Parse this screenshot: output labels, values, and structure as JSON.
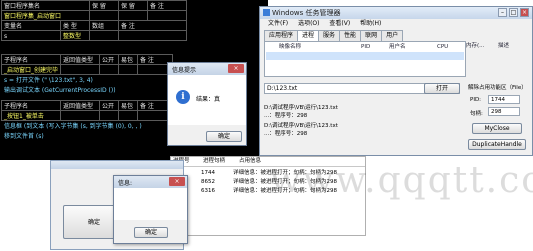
{
  "editor": {
    "table1_rows": [
      [
        "窗口程序集名",
        "保 留",
        "保 留",
        "备 注"
      ],
      [
        "窗口程序集_启动窗口",
        "",
        "",
        ""
      ],
      [
        "变量名",
        "类 型",
        "数组",
        "备 注"
      ],
      [
        "s",
        "整数型",
        "",
        ""
      ]
    ],
    "table2_header": [
      "子程序名",
      "返回值类型",
      "公开",
      "易包",
      "备 注"
    ],
    "table2_row": [
      "_启动窗口_创建完毕",
      "",
      "",
      "",
      ""
    ],
    "code_lines": [
      "s = 打开文件 (\" \\123.txt\", 3, 4)",
      "输出调试文本 (GetCurrentProcessID ())"
    ],
    "table3_header": [
      "子程序名",
      "返回值类型",
      "公开",
      "易包",
      "备 注"
    ],
    "table3_row": [
      "_按钮1_被单击",
      "",
      "",
      "",
      ""
    ],
    "code_lines2": [
      "信息框 (到文本 (写入字节集 (s, 到字节集 (0), 0, , )",
      "移到文件首 (s)"
    ]
  },
  "taskmgr": {
    "title": "Windows 任务管理器",
    "menu": [
      "文件(F)",
      "选项(O)",
      "查看(V)",
      "帮助(H)"
    ],
    "tabs": [
      "应用程序",
      "进程",
      "服务",
      "性能",
      "联网",
      "用户"
    ],
    "columns": [
      "映像名称",
      "PID",
      "用户名",
      "CPU",
      "内存(...",
      "描述"
    ],
    "file_path": "D:\\123.txt",
    "file_button": "打开",
    "log_lines": [
      "D:\\调试程序\\VB\\运行\\123.txt",
      "...：程序号：298",
      "D:\\调试程序\\VB\\运行\\123.txt",
      "...：程序号：298"
    ],
    "side_title": "解除占用功能区（File）",
    "pid_label": "PID:",
    "pid_value": "1744",
    "handle_label": "句柄:",
    "handle_value": "298",
    "btn_close": "MyClose",
    "btn_dup": "DuplicateHandle",
    "list_headers": [
      "进程号",
      "进程句柄",
      "占用信息"
    ],
    "list_rows": [
      [
        "1744",
        "详细信息：被进程打开；句柄：句柄为298"
      ],
      [
        "8652",
        "详细信息：被进程打开；句柄：句柄为298"
      ],
      [
        "6316",
        "详细信息：被进程打开；句柄：句柄为298"
      ]
    ]
  },
  "dialog1": {
    "title": "信息提示",
    "message": "结果：真",
    "ok": "确定"
  },
  "dialog2": {
    "title": "信息:",
    "ok": "确定"
  },
  "form": {
    "button": "确定"
  },
  "watermark": "www.qqqtt.com"
}
